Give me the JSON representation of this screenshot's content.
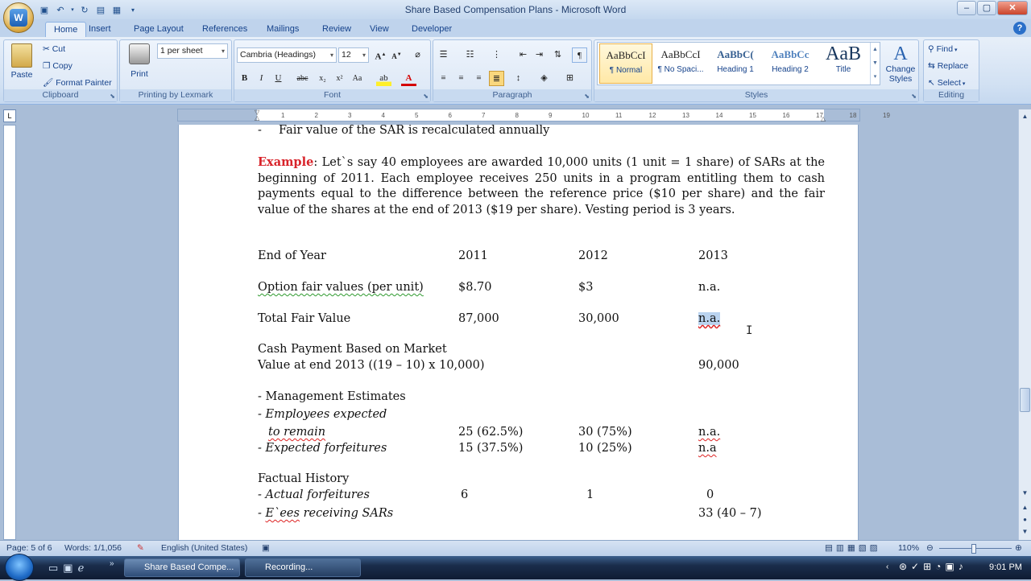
{
  "window": {
    "title": "Share Based Compensation Plans - Microsoft Word"
  },
  "tabs": [
    "Home",
    "Insert",
    "Page Layout",
    "References",
    "Mailings",
    "Review",
    "View",
    "Developer"
  ],
  "ribbon": {
    "clipboard": {
      "paste": "Paste",
      "cut": "Cut",
      "copy": "Copy",
      "format_painter": "Format Painter",
      "label": "Clipboard"
    },
    "printing": {
      "pages_value": "1 per sheet",
      "print": "Print",
      "label": "Printing by Lexmark"
    },
    "font": {
      "family": "Cambria (Headings)",
      "size": "12",
      "label": "Font"
    },
    "paragraph": {
      "label": "Paragraph"
    },
    "styles": {
      "items": [
        {
          "preview": "AaBbCcI",
          "name": "¶ Normal"
        },
        {
          "preview": "AaBbCcI",
          "name": "¶ No Spaci..."
        },
        {
          "preview": "AaBbC(",
          "name": "Heading 1"
        },
        {
          "preview": "AaBbCc",
          "name": "Heading 2"
        },
        {
          "preview": "AaB",
          "name": "Title"
        }
      ],
      "change_styles": "Change Styles",
      "label": "Styles"
    },
    "editing": {
      "find": "Find",
      "replace": "Replace",
      "select": "Select",
      "label": "Editing"
    }
  },
  "ruler": {
    "ticks": [
      "1",
      "2",
      "3",
      "4",
      "5",
      "6",
      "7",
      "8",
      "9",
      "10",
      "11",
      "12",
      "13",
      "14",
      "15",
      "16",
      "17",
      "18",
      "19"
    ]
  },
  "document": {
    "bullet_line": "Fair value of the SAR is recalculated annually",
    "example_label": "Example",
    "example_text": ":  Let`s say 40 employees are awarded 10,000 units (1 unit = 1 share) of SARs at the beginning of 2011.  Each employee receives 250 units in a program entitling them to cash payments equal to the difference between the reference price ($10 per share) and the fair value of the shares at the end of 2013 ($19 per share).  Vesting period is 3 years.",
    "header": {
      "label": "End of Year",
      "c1": "2011",
      "c2": "2012",
      "c3": "2013"
    },
    "fair_values": {
      "label": "Option fair values (per unit)",
      "c1": "$8.70",
      "c2": "$3",
      "c3": "n.a."
    },
    "total": {
      "label": "Total Fair Value",
      "c1": "87,000",
      "c2": "30,000",
      "c3": "n.a."
    },
    "cash1": "Cash Payment Based on Market",
    "cash2": "Value at end 2013 ((19 – 10) x 10,000)",
    "cash_c3": "90,000",
    "mgmt": "- Management Estimates",
    "exp1": "- Employees expected",
    "exp2": "to remain",
    "exp2_pre": "",
    "remain": {
      "c1": "25 (62.5%)",
      "c2": "30 (75%)",
      "c3": "n.a."
    },
    "forf": {
      "label": "- Expected forfeitures",
      "c1": "15 (37.5%)",
      "c2": "10 (25%)",
      "c3": "n.a"
    },
    "hist": "Factual History",
    "actual": {
      "label": "- Actual forfeitures",
      "c1": "6",
      "c2": "1",
      "c3": "0"
    },
    "ees": {
      "label_prefix": "- ",
      "label_squig": "E`ees",
      "label_rest": " receiving SARs",
      "c3": "33 (40 – 7)"
    }
  },
  "status": {
    "page": "Page: 5 of 6",
    "words": "Words: 1/1,056",
    "language": "English (United States)",
    "zoom": "110%"
  },
  "taskbar": {
    "btn1": "Share Based Compe...",
    "btn2": "Recording...",
    "time": "9:01 PM"
  }
}
